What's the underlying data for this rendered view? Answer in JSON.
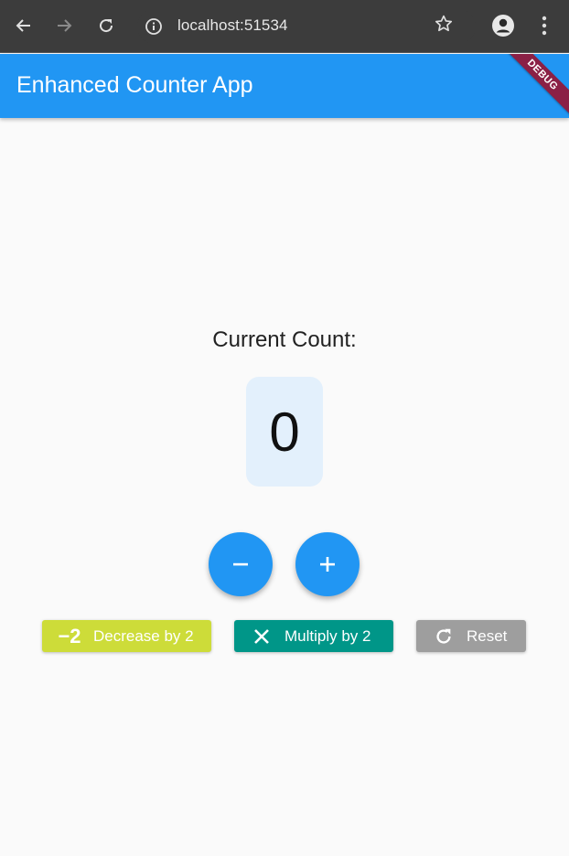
{
  "browser": {
    "url": "localhost:51534",
    "icons": [
      "back-arrow-icon",
      "forward-arrow-icon",
      "reload-icon",
      "info-icon",
      "star-icon",
      "profile-icon",
      "more-vert-icon"
    ]
  },
  "appbar": {
    "title": "Enhanced Counter App",
    "debug_label": "DEBUG",
    "color": "#2196f3"
  },
  "counter": {
    "label": "Current Count:",
    "value": "0"
  },
  "buttons": {
    "decrease_icon_text": "−2",
    "decrease_label": "Decrease by 2",
    "decrease_color": "#cddc39",
    "multiply_label": "Multiply by 2",
    "multiply_color": "#009688",
    "reset_label": "Reset",
    "reset_color": "#9e9e9e"
  }
}
